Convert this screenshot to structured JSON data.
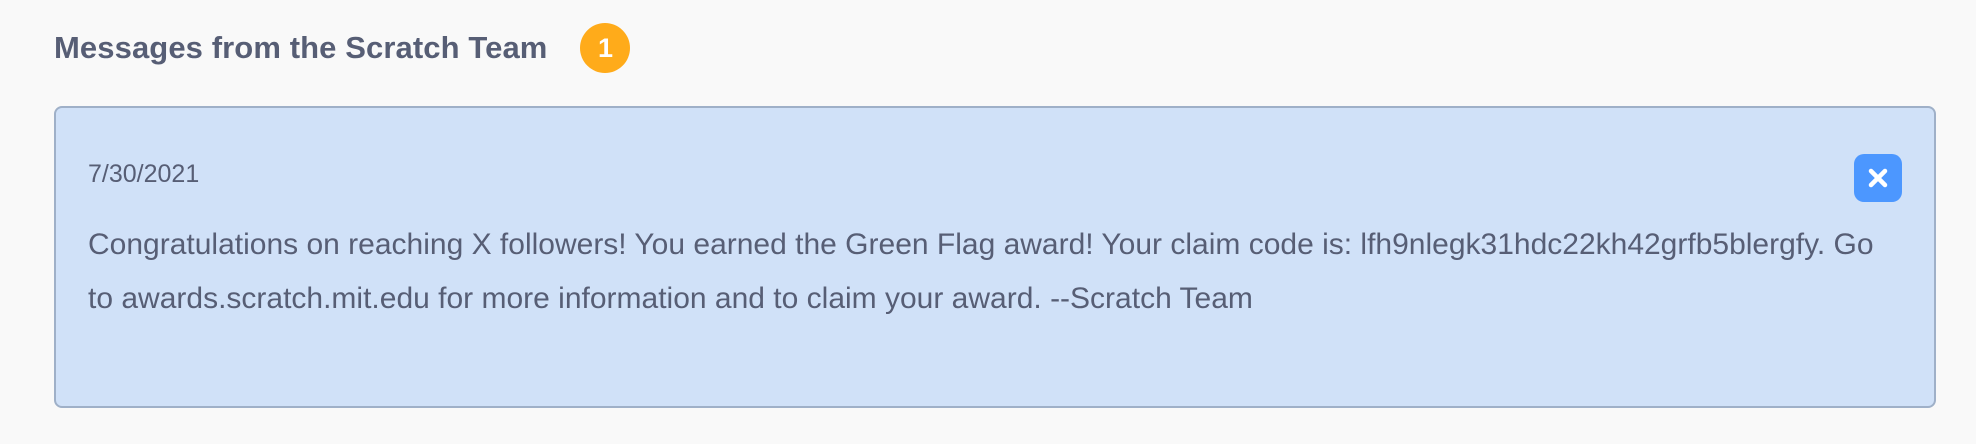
{
  "section": {
    "title": "Messages from the Scratch Team",
    "badge_count": "1",
    "badge_color": "#ffab1a"
  },
  "message": {
    "date": "7/30/2021",
    "body": "Congratulations on reaching X followers! You earned the Green Flag award! Your claim code is: lfh9nlegk31hdc22kh42grfb5blergfy. Go to awards.scratch.mit.edu for more information and to claim your award. --Scratch Team",
    "background_color": "#d0e1f8",
    "dismiss_icon": "close-icon",
    "dismiss_color": "#4c97ff"
  }
}
